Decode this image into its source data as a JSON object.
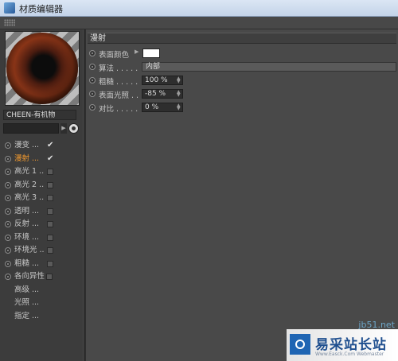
{
  "window": {
    "title": "材质编辑器"
  },
  "preview": {
    "material_name": "CHEEN-有机物"
  },
  "channels": [
    {
      "label": "漫变 ...",
      "checked": true,
      "active": false,
      "has_radio": true
    },
    {
      "label": "漫射 ...",
      "checked": true,
      "active": true,
      "has_radio": true
    },
    {
      "label": "高光 1 ..",
      "checked": false,
      "active": false,
      "has_radio": true
    },
    {
      "label": "高光 2 ..",
      "checked": false,
      "active": false,
      "has_radio": true
    },
    {
      "label": "高光 3 ..",
      "checked": false,
      "active": false,
      "has_radio": true
    },
    {
      "label": "透明 ...",
      "checked": false,
      "active": false,
      "has_radio": true
    },
    {
      "label": "反射 ...",
      "checked": false,
      "active": false,
      "has_radio": true
    },
    {
      "label": "环境 ...",
      "checked": false,
      "active": false,
      "has_radio": true
    },
    {
      "label": "环境光 ..",
      "checked": false,
      "active": false,
      "has_radio": true
    },
    {
      "label": "粗糙 ...",
      "checked": false,
      "active": false,
      "has_radio": true
    },
    {
      "label": "各向异性",
      "checked": false,
      "active": false,
      "has_radio": true
    },
    {
      "label": "高级 ...",
      "plain": true
    },
    {
      "label": "光照 ...",
      "plain": true
    },
    {
      "label": "指定 ...",
      "plain": true
    }
  ],
  "section": {
    "title": "漫射"
  },
  "props": {
    "surface_color": {
      "label": "表面颜色",
      "color": "#ffffff"
    },
    "algorithm": {
      "label": "算法 . . . . .",
      "value": "内部"
    },
    "roughness": {
      "label": "粗糙 . . . . .",
      "value": "100 %"
    },
    "surface_light": {
      "label": "表面光照 . .",
      "value": "-85 %"
    },
    "contrast": {
      "label": "对比 . . . . .",
      "value": "0 %"
    }
  },
  "watermark": {
    "url": "jb51.net",
    "brand": "易采站长站",
    "sub": "Www.Easck.Com Webmaster"
  },
  "colors": {
    "active_channel": "#f39a2e",
    "panel_bg": "#494949",
    "left_bg": "#3c3c3c"
  }
}
